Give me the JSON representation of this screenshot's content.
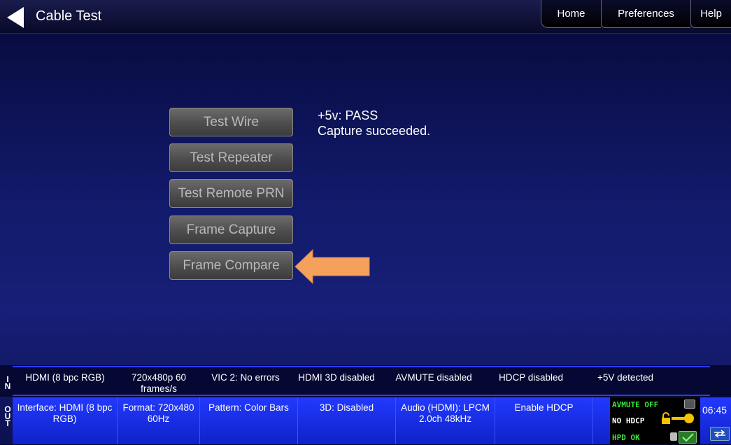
{
  "header": {
    "title": "Cable Test",
    "tabs": [
      "Home",
      "Preferences",
      "Help"
    ]
  },
  "buttons": [
    "Test Wire",
    "Test Repeater",
    "Test Remote PRN",
    "Frame Capture",
    "Frame Compare"
  ],
  "status": {
    "line1": "+5v: PASS",
    "line2": "Capture succeeded."
  },
  "in_bar": {
    "label": "IN",
    "cells": [
      "HDMI (8 bpc RGB)",
      "720x480p 60 frames/s",
      "VIC 2: No errors",
      "HDMI 3D disabled",
      "AVMUTE disabled",
      "HDCP disabled",
      "+5V detected"
    ]
  },
  "out_bar": {
    "label": "OUT",
    "cells": [
      "Interface: HDMI (8 bpc RGB)",
      "Format: 720x480 60Hz",
      "Pattern: Color Bars",
      "3D: Disabled",
      "Audio (HDMI): LPCM 2.0ch 48kHz",
      "Enable HDCP"
    ]
  },
  "status_panel": {
    "avmute": "AVMUTE OFF",
    "hdcp": "NO HDCP",
    "hpd": "HPD OK"
  },
  "clock": "06:45",
  "colors": {
    "accent_arrow": "#f5a15c",
    "out_bar": "#1a30f0",
    "status_green": "#39e639"
  }
}
